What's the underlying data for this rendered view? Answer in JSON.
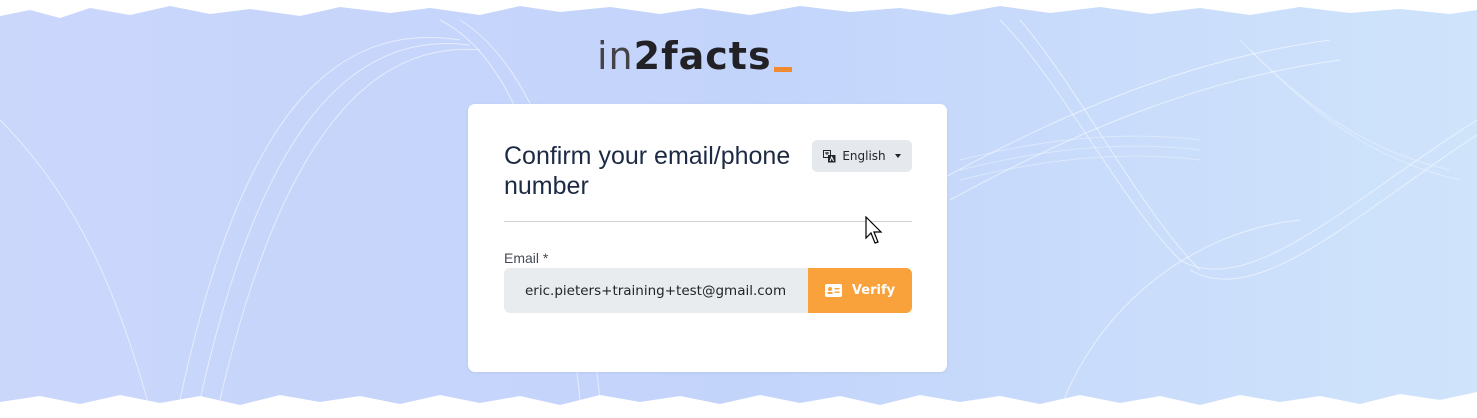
{
  "logo": {
    "part1": "in",
    "part2": "2facts"
  },
  "card": {
    "title": "Confirm your email/phone number",
    "language": {
      "label": "English",
      "icon": "translate-icon"
    },
    "email": {
      "label": "Email *",
      "value": "eric.pieters+training+test@gmail.com"
    },
    "verify": {
      "label": "Verify",
      "icon": "id-card-icon"
    }
  },
  "colors": {
    "accent": "#f9a13a",
    "logo_dash": "#f28b2f",
    "title": "#1d2a44",
    "background": "#c9dafc"
  }
}
